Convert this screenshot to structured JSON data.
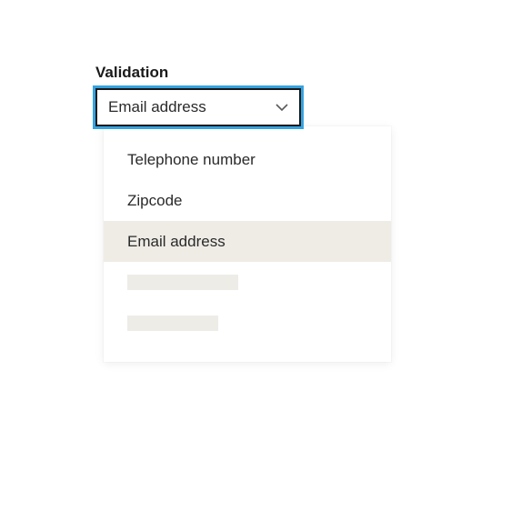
{
  "field": {
    "label": "Validation",
    "selected_value": "Email address"
  },
  "dropdown": {
    "options": [
      {
        "label": "Telephone number",
        "highlighted": false
      },
      {
        "label": "Zipcode",
        "highlighted": false
      },
      {
        "label": "Email address",
        "highlighted": true
      }
    ]
  },
  "colors": {
    "focus_ring": "#36a3e0",
    "highlight_bg": "#efece6",
    "placeholder_bg": "#eeece7"
  }
}
